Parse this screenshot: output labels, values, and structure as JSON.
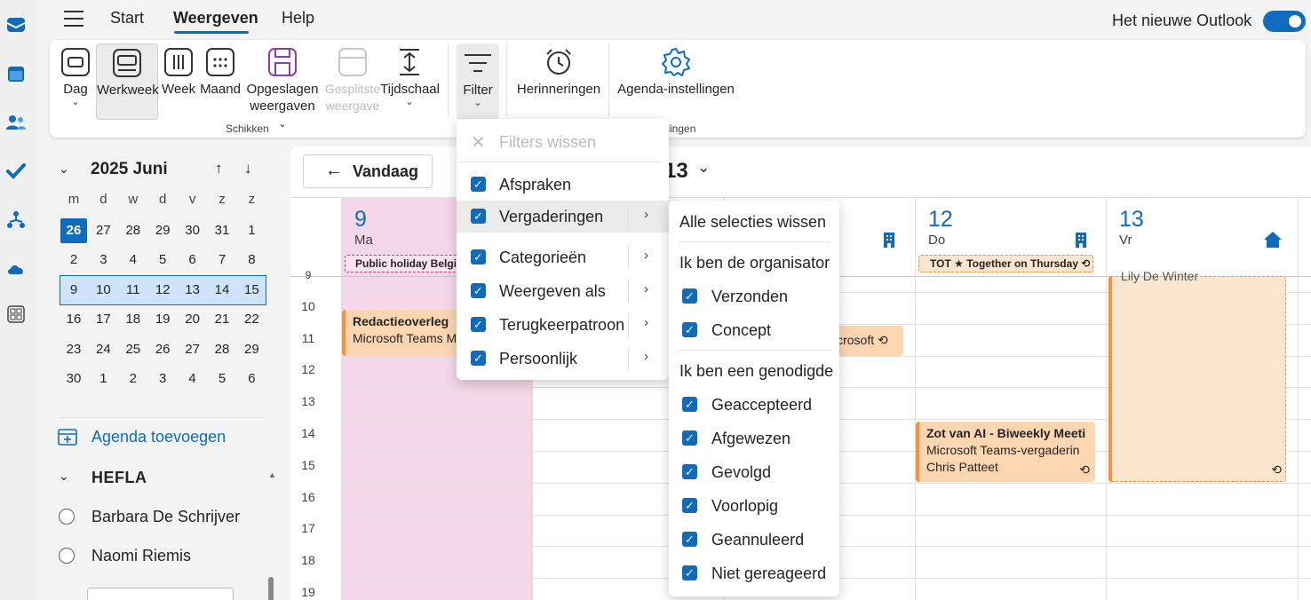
{
  "menubar": {
    "tabs": [
      {
        "label": "Start"
      },
      {
        "label": "Weergeven"
      },
      {
        "label": "Help"
      }
    ],
    "new_outlook_label": "Het nieuwe Outlook"
  },
  "ribbon": {
    "buttons": {
      "dag": "Dag",
      "werkweek": "Werkweek",
      "week": "Week",
      "maand": "Maand",
      "opgeslagen_1": "Opgeslagen",
      "opgeslagen_2": "weergaven",
      "gesplitste_1": "Gesplitste",
      "gesplitste_2": "weergave",
      "tijdschaal": "Tijdschaal",
      "filter": "Filter",
      "herinneringen": "Herinneringen",
      "agenda_instellingen": "Agenda-instellingen"
    },
    "groups": {
      "schikken": "Schikken",
      "instellingen_partial": "ellingen"
    }
  },
  "sidebar": {
    "month_title": "2025 Juni",
    "weekdays": [
      "m",
      "d",
      "w",
      "d",
      "v",
      "z",
      "z"
    ],
    "weeks": [
      [
        "26",
        "27",
        "28",
        "29",
        "30",
        "31",
        "1"
      ],
      [
        "2",
        "3",
        "4",
        "5",
        "6",
        "7",
        "8"
      ],
      [
        "9",
        "10",
        "11",
        "12",
        "13",
        "14",
        "15"
      ],
      [
        "16",
        "17",
        "18",
        "19",
        "20",
        "21",
        "22"
      ],
      [
        "23",
        "24",
        "25",
        "26",
        "27",
        "28",
        "29"
      ],
      [
        "30",
        "1",
        "2",
        "3",
        "4",
        "5",
        "6"
      ]
    ],
    "add_calendar": "Agenda toevoegen",
    "group_name": "HEFLA",
    "people": [
      "Barbara De Schrijver",
      "Naomi Riemis"
    ]
  },
  "calendar": {
    "today_button": "Vandaag",
    "range_partial": "13",
    "days": [
      {
        "num": "9",
        "name": "Ma"
      },
      {
        "num": "12",
        "name": "Do"
      },
      {
        "num": "13",
        "name": "Vr"
      }
    ],
    "hours": [
      "9",
      "10",
      "11",
      "12",
      "13",
      "14",
      "15",
      "16",
      "17",
      "18",
      "19"
    ],
    "allday": {
      "holiday": "Public holiday Belgiu",
      "tot": "TOT ★ Together on Thursday"
    },
    "events": {
      "redactie_title": "Redactieoverleg",
      "redactie_sub": "Microsoft Teams M",
      "wed_partial": "icrosoft",
      "zot_title": "Zot van AI - Biweekly Meeti",
      "zot_sub": "Microsoft Teams-vergaderin",
      "zot_person": "Chris Patteet",
      "lily": "Lily De Winter"
    }
  },
  "filter_menu": {
    "clear": "Filters wissen",
    "items": [
      {
        "label": "Afspraken",
        "checked": true
      },
      {
        "label": "Vergaderingen",
        "checked": true
      },
      {
        "label": "Categorieën",
        "checked": true
      },
      {
        "label": "Weergeven als",
        "checked": true
      },
      {
        "label": "Terugkeerpatroon",
        "checked": true
      },
      {
        "label": "Persoonlijk",
        "checked": true
      }
    ]
  },
  "submenu": {
    "clear_all": "Alle selecties wissen",
    "organizer_heading": "Ik ben de organisator",
    "organizer_items": [
      "Verzonden",
      "Concept"
    ],
    "invitee_heading": "Ik ben een genodigde",
    "invitee_items": [
      "Geaccepteerd",
      "Afgewezen",
      "Gevolgd",
      "Voorlopig",
      "Geannuleerd",
      "Niet gereageerd"
    ]
  },
  "colors": {
    "accent": "#0f6cbd",
    "event_fill": "#fcd6b0",
    "event_border": "#f7913a",
    "monday_tint": "#f4d7e8"
  }
}
